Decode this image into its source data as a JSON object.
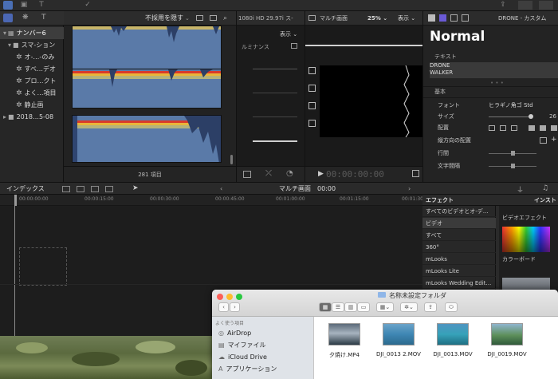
{
  "toolbar": {
    "fit_label": "不採用を隠す",
    "format_label": "1080i HD 29.97i ス-",
    "scope_title": "マルチ画面",
    "zoom_label": "25%",
    "view_label": "表示",
    "project_title": "DRONE - カスタム"
  },
  "library": {
    "name": "ナンバー6",
    "items": [
      {
        "label": "スマ-ション",
        "indent": 1
      },
      {
        "label": "オ-…-のみ",
        "indent": 2
      },
      {
        "label": "すべ…デオ",
        "indent": 2
      },
      {
        "label": "プロ…クト",
        "indent": 2
      },
      {
        "label": "よく…項目",
        "indent": 2
      },
      {
        "label": "静止画",
        "indent": 2
      },
      {
        "label": "2018…5-08",
        "indent": 0
      }
    ]
  },
  "browser": {
    "count_label": "281 項目"
  },
  "scope": {
    "view_label": "表示",
    "type_label": "ルミナンス"
  },
  "viewer": {
    "timecode": "00:00:00:00"
  },
  "inspector": {
    "title": "Normal",
    "text_section": "テキスト",
    "text_lines": [
      "DRONE",
      "WALKER"
    ],
    "basic_section": "基本",
    "rows": [
      {
        "label": "フォント",
        "value": "ヒラギノ角ゴ Std"
      },
      {
        "label": "サイズ",
        "value": "26"
      },
      {
        "label": "配置",
        "value": ""
      },
      {
        "label": "縦方向の配置",
        "value": ""
      },
      {
        "label": "行間",
        "value": ""
      },
      {
        "label": "文字間隔",
        "value": ""
      }
    ]
  },
  "timeline": {
    "index_label": "インデックス",
    "title": "マルチ画面",
    "timecode": "00:00",
    "ruler": [
      "00:00:00:00",
      "00:00:15:00",
      "00:00:30:00",
      "00:00:45:00",
      "00:01:00:00",
      "00:01:15:00",
      "00:01:30"
    ]
  },
  "effects": {
    "title": "エフェクト",
    "right_title": "インスト",
    "items": [
      "すべてのビデオとオ-デ…",
      "ビデオ",
      "すべて",
      "360°",
      "mLooks",
      "mLooks Lite",
      "mLooks Wedding Edit…",
      ""
    ],
    "selected_index": 1,
    "grid_label": "ビデオエフェクト",
    "thumb_label": "カラーボード"
  },
  "finder": {
    "title": "名称未設定フォルダ",
    "sidebar_header": "よく使う項目",
    "sidebar": [
      "AirDrop",
      "マイファイル",
      "iCloud Drive",
      "アプリケーション"
    ],
    "files": [
      "夕焼け.MP4",
      "DJI_0013 2.MOV",
      "DJI_0013.MOV",
      "DJI_0019.MOV"
    ]
  }
}
